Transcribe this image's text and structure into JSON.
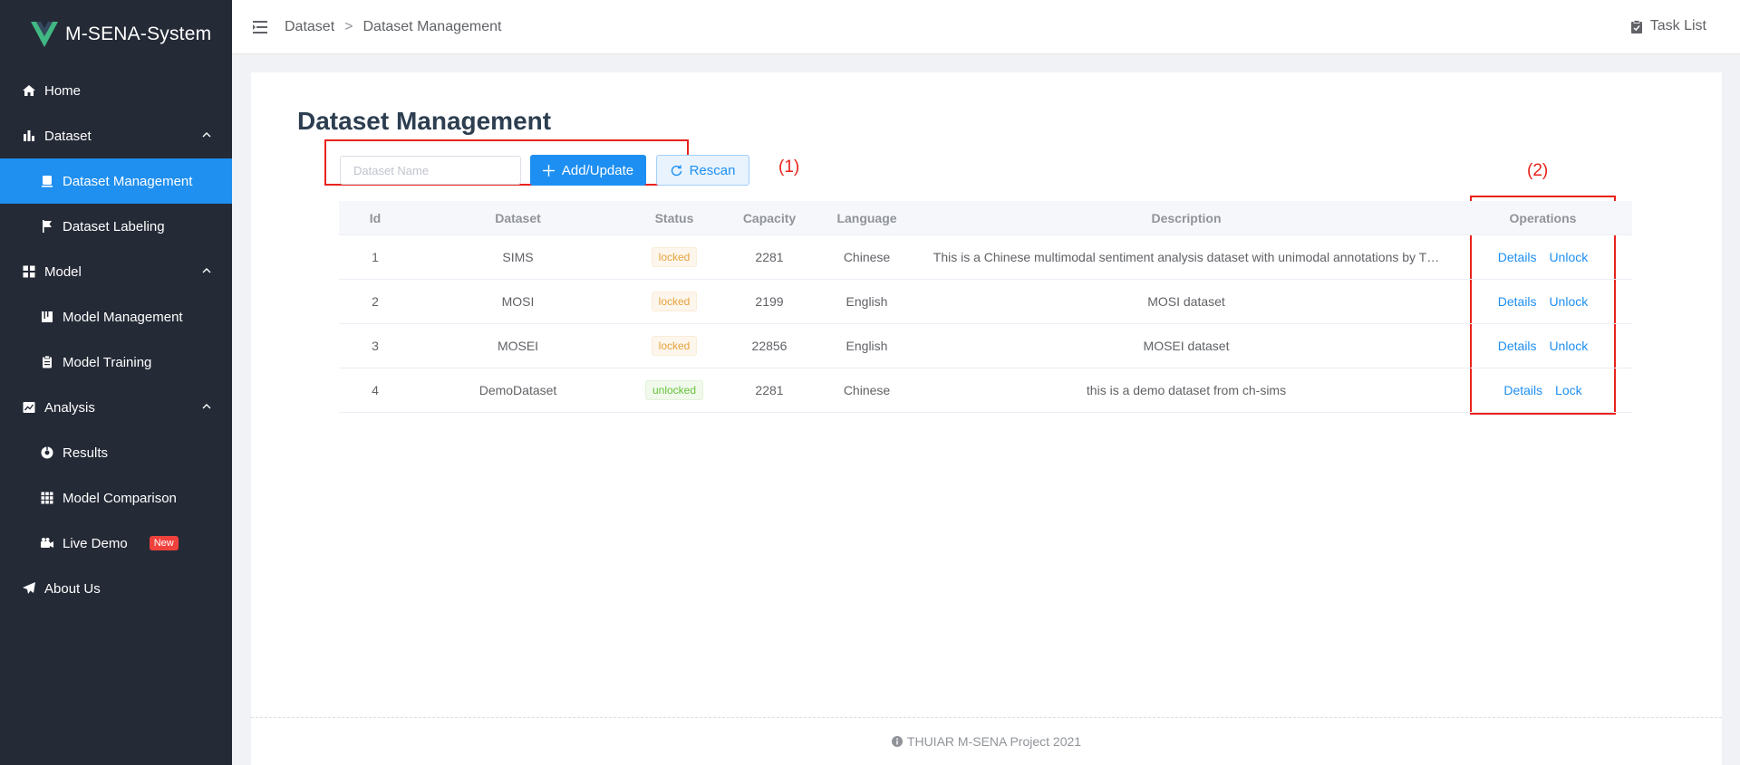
{
  "app": {
    "title": "M-SENA-System"
  },
  "sidebar": {
    "items": [
      {
        "label": "Home",
        "icon": "home-icon"
      },
      {
        "label": "Dataset",
        "icon": "bar-chart-icon"
      },
      {
        "label": "Dataset Management",
        "icon": "dataset-management-icon"
      },
      {
        "label": "Dataset Labeling",
        "icon": "flag-icon"
      },
      {
        "label": "Model",
        "icon": "grid-icon"
      },
      {
        "label": "Model Management",
        "icon": "book-icon"
      },
      {
        "label": "Model Training",
        "icon": "clipboard-icon"
      },
      {
        "label": "Analysis",
        "icon": "line-chart-icon"
      },
      {
        "label": "Results",
        "icon": "results-icon"
      },
      {
        "label": "Model Comparison",
        "icon": "table-grid-icon"
      },
      {
        "label": "Live Demo",
        "icon": "video-camera-icon",
        "badge": "New"
      },
      {
        "label": "About Us",
        "icon": "send-icon"
      }
    ],
    "active_color": "#1f8ff0",
    "background": "#242a36"
  },
  "header": {
    "breadcrumb": [
      "Dataset",
      "Dataset Management"
    ],
    "breadcrumb_sep": ">",
    "task_list": "Task List"
  },
  "main": {
    "title": "Dataset Management",
    "search": {
      "placeholder": "Dataset Name",
      "value": ""
    },
    "add_button": "Add/Update",
    "rescan_button": "Rescan",
    "annotations": [
      "(1)",
      "(2)"
    ],
    "table": {
      "columns": [
        "Id",
        "Dataset",
        "Status",
        "Capacity",
        "Language",
        "Description",
        "Operations"
      ],
      "rows": [
        {
          "id": "1",
          "dataset": "SIMS",
          "status": "locked",
          "capacity": "2281",
          "language": "Chinese",
          "description": "This is a Chinese multimodal sentiment analysis dataset with unimodal annotations by T…",
          "ops": [
            "Details",
            "Unlock"
          ]
        },
        {
          "id": "2",
          "dataset": "MOSI",
          "status": "locked",
          "capacity": "2199",
          "language": "English",
          "description": "MOSI dataset",
          "ops": [
            "Details",
            "Unlock"
          ]
        },
        {
          "id": "3",
          "dataset": "MOSEI",
          "status": "locked",
          "capacity": "22856",
          "language": "English",
          "description": "MOSEI dataset",
          "ops": [
            "Details",
            "Unlock"
          ]
        },
        {
          "id": "4",
          "dataset": "DemoDataset",
          "status": "unlocked",
          "capacity": "2281",
          "language": "Chinese",
          "description": "this is a demo dataset from ch-sims",
          "ops": [
            "Details",
            "Lock"
          ]
        }
      ]
    }
  },
  "footer": {
    "text": "THUIAR M-SENA Project 2021"
  }
}
